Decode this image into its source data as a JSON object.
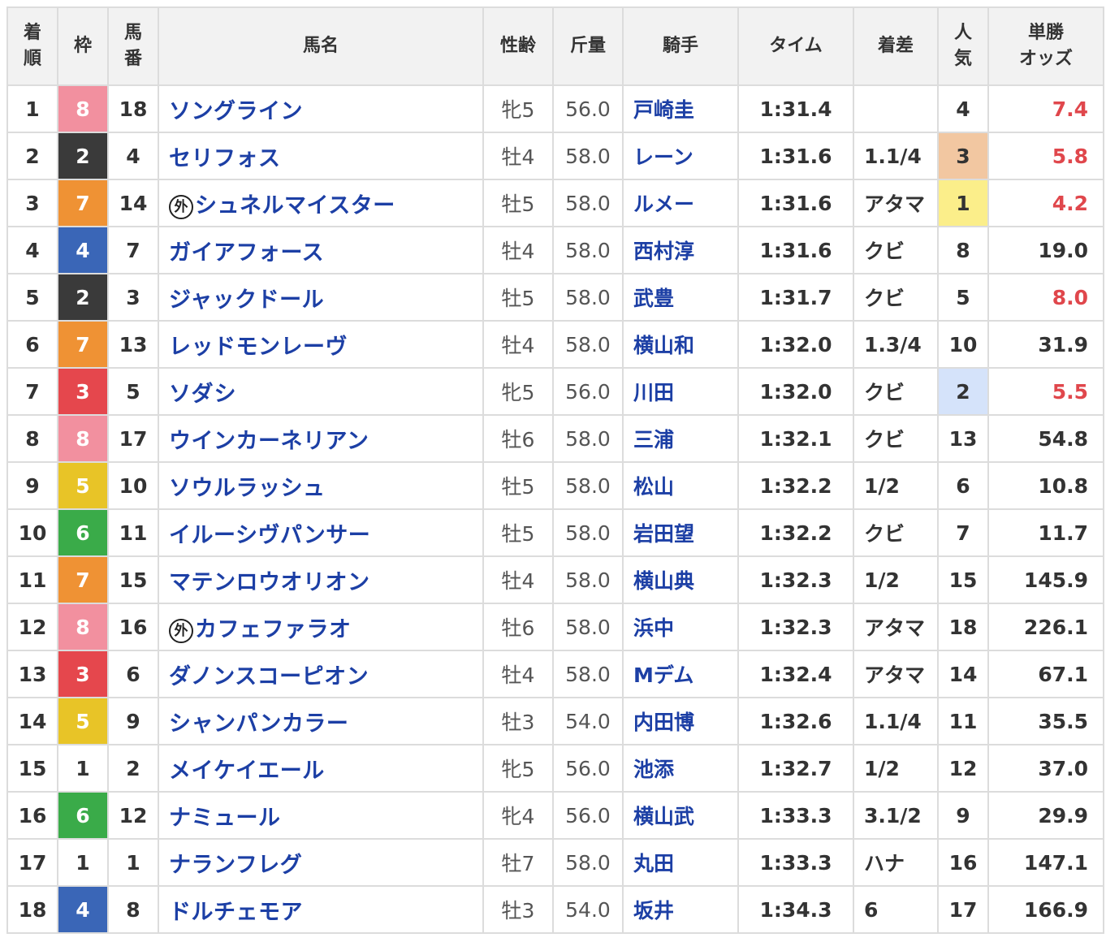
{
  "headers": {
    "rank": [
      "着",
      "順"
    ],
    "waku": "枠",
    "umaban": [
      "馬",
      "番"
    ],
    "horse": "馬名",
    "sexage": "性齢",
    "weight": "斤量",
    "jockey": "騎手",
    "time": "タイム",
    "margin": "着差",
    "pop": [
      "人",
      "気"
    ],
    "odds": [
      "単勝",
      "オッズ"
    ]
  },
  "foreign_mark": "外",
  "colors": {
    "waku": {
      "1": "#ffffff",
      "2": "#3a3a3a",
      "3": "#e5474d",
      "4": "#3a66b7",
      "5": "#e8c427",
      "6": "#3aab49",
      "7": "#ef9234",
      "8": "#f2909f"
    },
    "pop_1": "#fbee8a",
    "pop_2": "#d5e3fa",
    "pop_3": "#f2c7a1",
    "odds_fav": "#e0474c"
  },
  "rows": [
    {
      "rank": "1",
      "waku": "8",
      "umaban": "18",
      "foreign": false,
      "horse": "ソングライン",
      "sexage": "牝5",
      "weight": "56.0",
      "jockey": "戸崎圭",
      "time": "1:31.4",
      "margin": "",
      "pop": "4",
      "odds": "7.4"
    },
    {
      "rank": "2",
      "waku": "2",
      "umaban": "4",
      "foreign": false,
      "horse": "セリフォス",
      "sexage": "牡4",
      "weight": "58.0",
      "jockey": "レーン",
      "time": "1:31.6",
      "margin": "1.1/4",
      "pop": "3",
      "odds": "5.8"
    },
    {
      "rank": "3",
      "waku": "7",
      "umaban": "14",
      "foreign": true,
      "horse": "シュネルマイスター",
      "sexage": "牡5",
      "weight": "58.0",
      "jockey": "ルメー",
      "time": "1:31.6",
      "margin": "アタマ",
      "pop": "1",
      "odds": "4.2"
    },
    {
      "rank": "4",
      "waku": "4",
      "umaban": "7",
      "foreign": false,
      "horse": "ガイアフォース",
      "sexage": "牡4",
      "weight": "58.0",
      "jockey": "西村淳",
      "time": "1:31.6",
      "margin": "クビ",
      "pop": "8",
      "odds": "19.0"
    },
    {
      "rank": "5",
      "waku": "2",
      "umaban": "3",
      "foreign": false,
      "horse": "ジャックドール",
      "sexage": "牡5",
      "weight": "58.0",
      "jockey": "武豊",
      "time": "1:31.7",
      "margin": "クビ",
      "pop": "5",
      "odds": "8.0"
    },
    {
      "rank": "6",
      "waku": "7",
      "umaban": "13",
      "foreign": false,
      "horse": "レッドモンレーヴ",
      "sexage": "牡4",
      "weight": "58.0",
      "jockey": "横山和",
      "time": "1:32.0",
      "margin": "1.3/4",
      "pop": "10",
      "odds": "31.9"
    },
    {
      "rank": "7",
      "waku": "3",
      "umaban": "5",
      "foreign": false,
      "horse": "ソダシ",
      "sexage": "牝5",
      "weight": "56.0",
      "jockey": "川田",
      "time": "1:32.0",
      "margin": "クビ",
      "pop": "2",
      "odds": "5.5"
    },
    {
      "rank": "8",
      "waku": "8",
      "umaban": "17",
      "foreign": false,
      "horse": "ウインカーネリアン",
      "sexage": "牡6",
      "weight": "58.0",
      "jockey": "三浦",
      "time": "1:32.1",
      "margin": "クビ",
      "pop": "13",
      "odds": "54.8"
    },
    {
      "rank": "9",
      "waku": "5",
      "umaban": "10",
      "foreign": false,
      "horse": "ソウルラッシュ",
      "sexage": "牡5",
      "weight": "58.0",
      "jockey": "松山",
      "time": "1:32.2",
      "margin": "1/2",
      "pop": "6",
      "odds": "10.8"
    },
    {
      "rank": "10",
      "waku": "6",
      "umaban": "11",
      "foreign": false,
      "horse": "イルーシヴパンサー",
      "sexage": "牡5",
      "weight": "58.0",
      "jockey": "岩田望",
      "time": "1:32.2",
      "margin": "クビ",
      "pop": "7",
      "odds": "11.7"
    },
    {
      "rank": "11",
      "waku": "7",
      "umaban": "15",
      "foreign": false,
      "horse": "マテンロウオリオン",
      "sexage": "牡4",
      "weight": "58.0",
      "jockey": "横山典",
      "time": "1:32.3",
      "margin": "1/2",
      "pop": "15",
      "odds": "145.9"
    },
    {
      "rank": "12",
      "waku": "8",
      "umaban": "16",
      "foreign": true,
      "horse": "カフェファラオ",
      "sexage": "牡6",
      "weight": "58.0",
      "jockey": "浜中",
      "time": "1:32.3",
      "margin": "アタマ",
      "pop": "18",
      "odds": "226.1"
    },
    {
      "rank": "13",
      "waku": "3",
      "umaban": "6",
      "foreign": false,
      "horse": "ダノンスコーピオン",
      "sexage": "牡4",
      "weight": "58.0",
      "jockey": "Mデム",
      "time": "1:32.4",
      "margin": "アタマ",
      "pop": "14",
      "odds": "67.1"
    },
    {
      "rank": "14",
      "waku": "5",
      "umaban": "9",
      "foreign": false,
      "horse": "シャンパンカラー",
      "sexage": "牡3",
      "weight": "54.0",
      "jockey": "内田博",
      "time": "1:32.6",
      "margin": "1.1/4",
      "pop": "11",
      "odds": "35.5"
    },
    {
      "rank": "15",
      "waku": "1",
      "umaban": "2",
      "foreign": false,
      "horse": "メイケイエール",
      "sexage": "牝5",
      "weight": "56.0",
      "jockey": "池添",
      "time": "1:32.7",
      "margin": "1/2",
      "pop": "12",
      "odds": "37.0"
    },
    {
      "rank": "16",
      "waku": "6",
      "umaban": "12",
      "foreign": false,
      "horse": "ナミュール",
      "sexage": "牝4",
      "weight": "56.0",
      "jockey": "横山武",
      "time": "1:33.3",
      "margin": "3.1/2",
      "pop": "9",
      "odds": "29.9"
    },
    {
      "rank": "17",
      "waku": "1",
      "umaban": "1",
      "foreign": false,
      "horse": "ナランフレグ",
      "sexage": "牡7",
      "weight": "58.0",
      "jockey": "丸田",
      "time": "1:33.3",
      "margin": "ハナ",
      "pop": "16",
      "odds": "147.1"
    },
    {
      "rank": "18",
      "waku": "4",
      "umaban": "8",
      "foreign": false,
      "horse": "ドルチェモア",
      "sexage": "牡3",
      "weight": "54.0",
      "jockey": "坂井",
      "time": "1:34.3",
      "margin": "6",
      "pop": "17",
      "odds": "166.9"
    }
  ]
}
